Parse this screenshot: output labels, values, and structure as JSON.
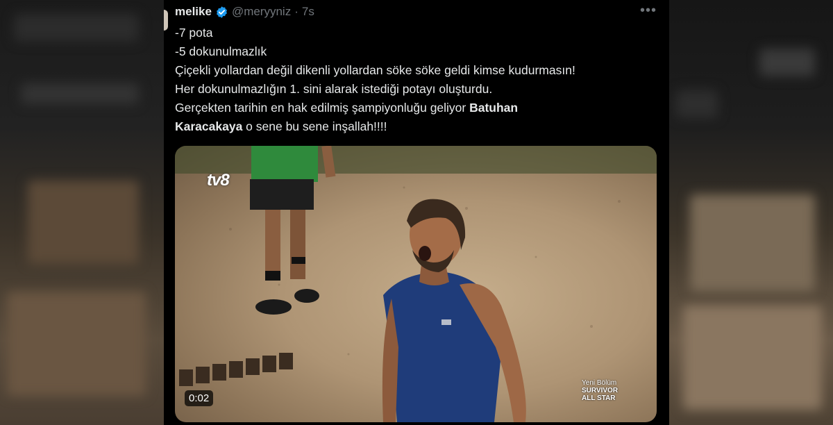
{
  "tweet": {
    "author_name": "melike",
    "handle": "@meryyniz",
    "separator": "·",
    "time": "7s",
    "more_icon": "more-horizontal-icon",
    "lines": [
      "-7 pota",
      "-5 dokunulmazlık",
      "Çiçekli yollardan değil dikenli yollardan söke söke geldi kimse kudurmasın!",
      "Her dokunulmazlığın 1. sini alarak istediği potayı oluşturdu."
    ],
    "line5_prefix": "Gerçekten tarihin en hak edilmiş şampiyonluğu geliyor ",
    "line5_bold": "Batuhan",
    "line6_bold": "Karacakaya",
    "line6_suffix": " o sene bu sene inşallah!!!!"
  },
  "media": {
    "duration": "0:02",
    "channel_logo": "tv8",
    "overlay_line1": "Yeni Bölüm",
    "overlay_line2": "SURVIVOR",
    "overlay_line3": "ALL STAR"
  },
  "colors": {
    "background": "#000000",
    "text": "#e7e9ea",
    "muted": "#71767b",
    "verified": "#1d9bf0"
  }
}
